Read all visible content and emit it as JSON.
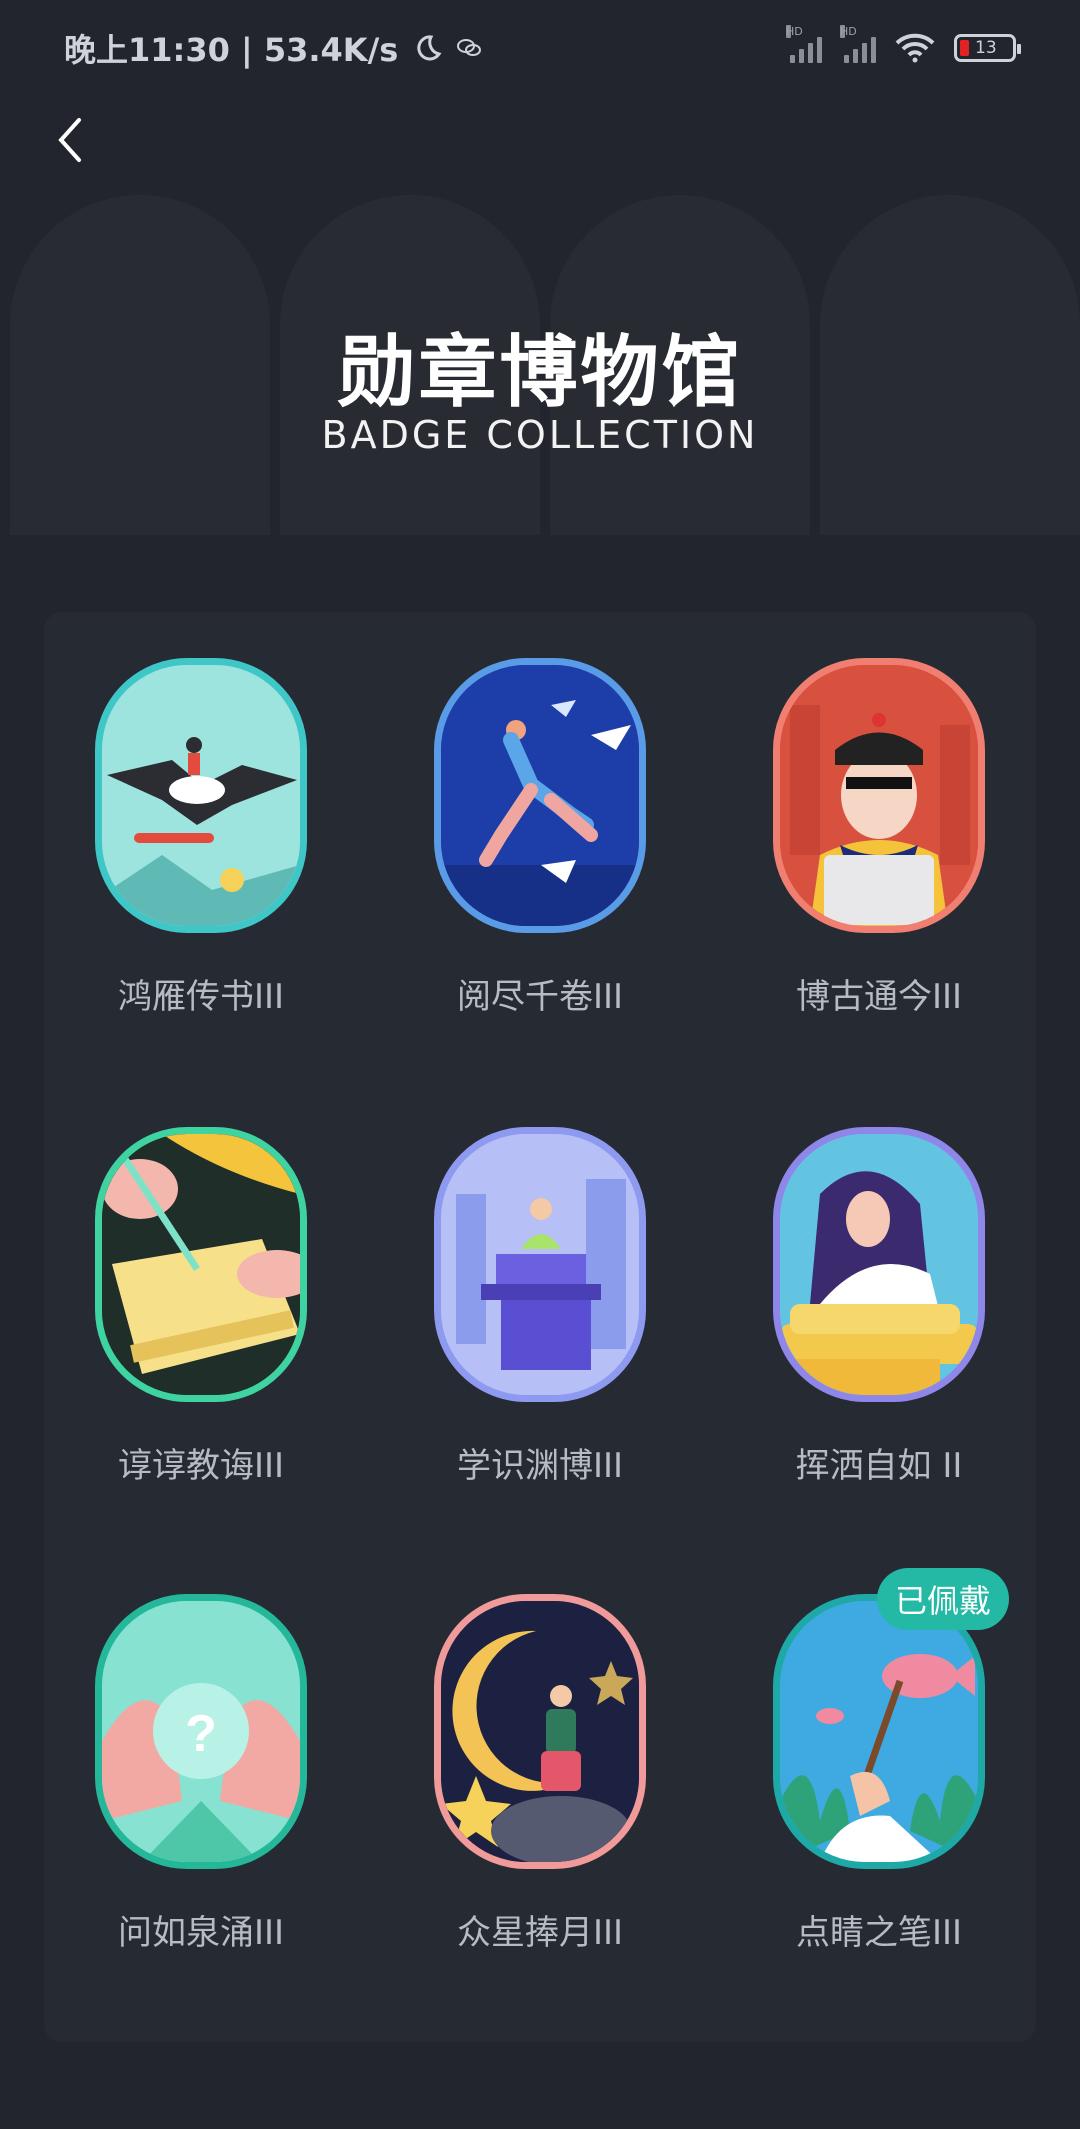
{
  "status_bar": {
    "time_speed": "晚上11:30 | 53.4K/s",
    "battery_level": "13",
    "icons": [
      "moon-icon",
      "chat-icon",
      "signal-hd-icon",
      "signal-hd-icon",
      "wifi-icon",
      "battery-icon"
    ]
  },
  "header": {
    "title": "勋章博物馆",
    "subtitle": "BADGE COLLECTION"
  },
  "badges": [
    {
      "name": "鸿雁传书III",
      "frame_color": "#3fc7c8",
      "bg": "#7fdad7"
    },
    {
      "name": "阅尽千卷III",
      "frame_color": "#5a9be8",
      "bg": "#1b3fa6"
    },
    {
      "name": "博古通今III",
      "frame_color": "#f07f72",
      "bg": "#d6503e"
    },
    {
      "name": "谆谆教诲III",
      "frame_color": "#3ed3a0",
      "bg": "#1d2a26"
    },
    {
      "name": "学识渊博III",
      "frame_color": "#8d9af0",
      "bg": "#a9b4f4"
    },
    {
      "name": "挥洒自如 II",
      "frame_color": "#8f86ea",
      "bg": "#66c5e4"
    },
    {
      "name": "问如泉涌III",
      "frame_color": "#25b79a",
      "bg": "#7fe1cf"
    },
    {
      "name": "众星捧月III",
      "frame_color": "#f19a9a",
      "bg": "#1c2140"
    },
    {
      "name": "点睛之笔III",
      "frame_color": "#1fa9a6",
      "bg": "#3aa8e0",
      "worn_label": "已佩戴"
    }
  ]
}
